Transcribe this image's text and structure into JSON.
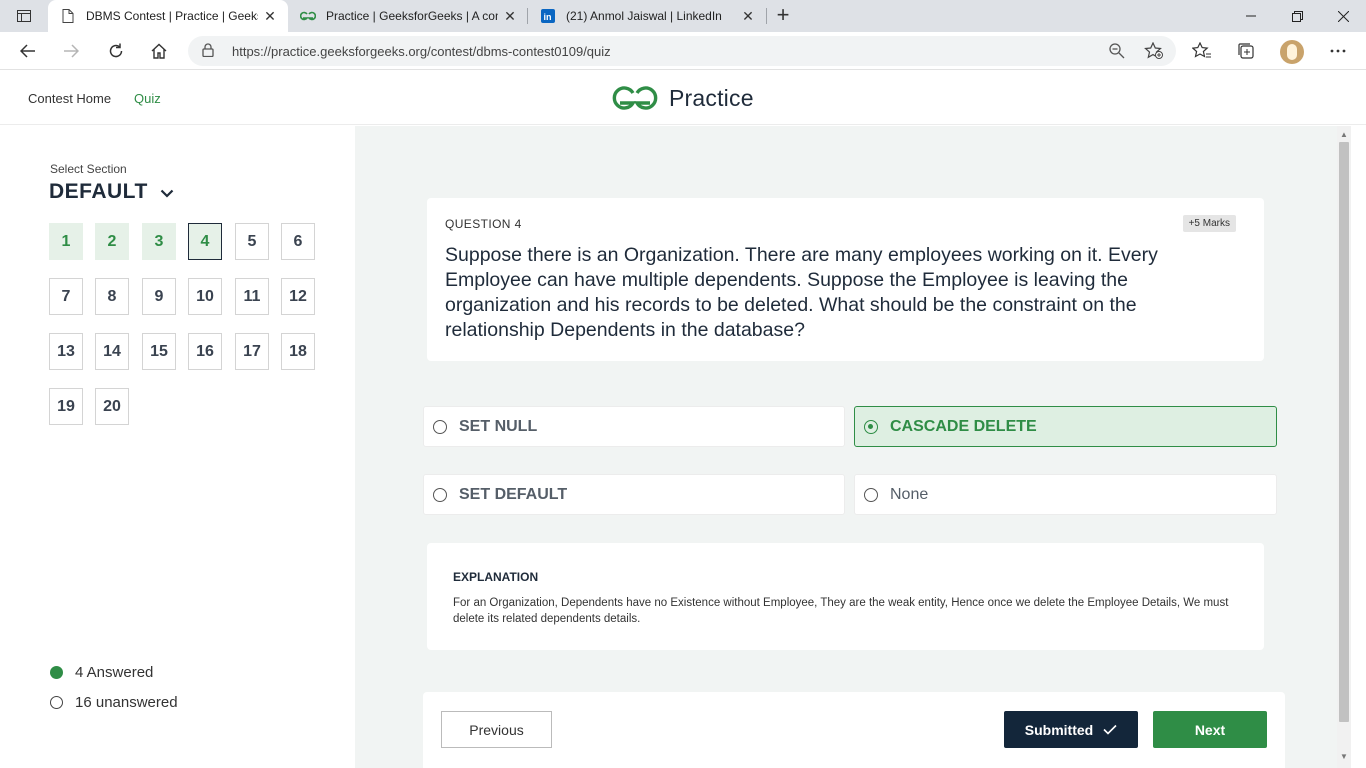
{
  "browser": {
    "tabs": [
      {
        "title": "DBMS Contest | Practice | Geeksf",
        "active": true,
        "favicon": "document-icon"
      },
      {
        "title": "Practice | GeeksforGeeks | A com",
        "active": false,
        "favicon": "gfg-icon"
      },
      {
        "title": "(21) Anmol Jaiswal | LinkedIn",
        "active": false,
        "favicon": "linkedin-icon"
      }
    ],
    "url": "https://practice.geeksforgeeks.org/contest/dbms-contest0109/quiz"
  },
  "header": {
    "nav": [
      "Contest Home",
      "Quiz"
    ],
    "active_nav": "Quiz",
    "logo_text": "Practice"
  },
  "sidebar": {
    "section_label": "Select Section",
    "section_value": "DEFAULT",
    "questions": [
      "1",
      "2",
      "3",
      "4",
      "5",
      "6",
      "7",
      "8",
      "9",
      "10",
      "11",
      "12",
      "13",
      "14",
      "15",
      "16",
      "17",
      "18",
      "19",
      "20"
    ],
    "answered": [
      "1",
      "2",
      "3",
      "4"
    ],
    "current": "4",
    "answered_text": "4 Answered",
    "unanswered_text": "16 unanswered"
  },
  "question": {
    "label": "QUESTION 4",
    "marks": "+5 Marks",
    "text": "Suppose there is an Organization. There are many employees working on it. Every Employee can have multiple dependents. Suppose the Employee is leaving the organization and his records to be deleted. What should be the constraint on the relationship Dependents in the database?",
    "options": [
      "SET NULL",
      "CASCADE DELETE",
      "SET DEFAULT",
      "None"
    ],
    "selected": "CASCADE DELETE"
  },
  "explanation": {
    "title": "EXPLANATION",
    "text": "For an Organization, Dependents have no Existence without Employee, They are the weak entity, Hence once we delete the Employee Details, We must delete its related dependents details."
  },
  "footer": {
    "previous": "Previous",
    "submitted": "Submitted",
    "next": "Next"
  },
  "colors": {
    "brand_green": "#2f8d46",
    "dark_navy": "#13263a",
    "answered_bg": "#e6f1e8",
    "main_bg": "#f1f4f3"
  }
}
